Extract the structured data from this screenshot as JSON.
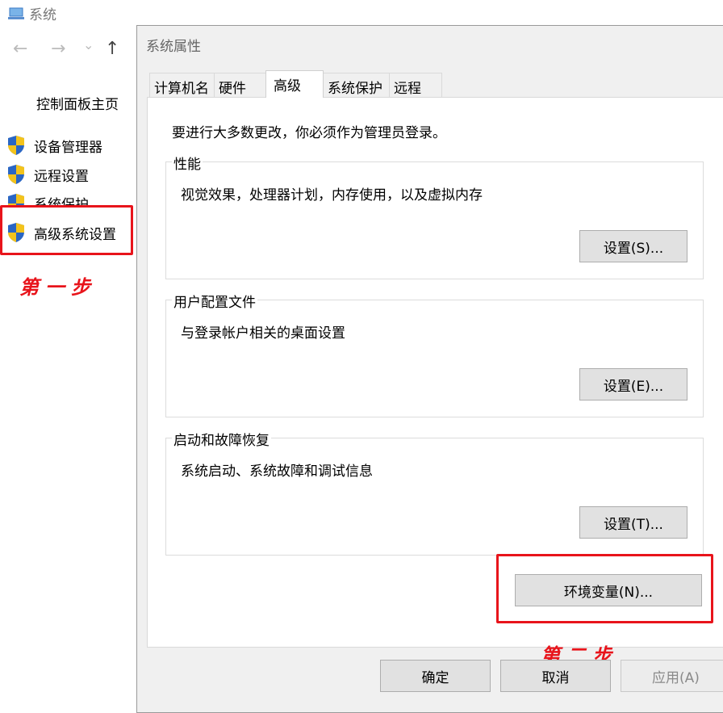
{
  "window": {
    "title": "系统"
  },
  "nav": {
    "back": "←",
    "forward": "→",
    "dropdown": "⌄",
    "up": "↑"
  },
  "sidebar": {
    "home": "控制面板主页",
    "items": [
      {
        "label": "设备管理器"
      },
      {
        "label": "远程设置"
      },
      {
        "label": "系统保护"
      },
      {
        "label": "高级系统设置"
      }
    ]
  },
  "annotations": {
    "step1": "第一步",
    "step2": "第二步",
    "highlight_color": "#e8141b"
  },
  "dialog": {
    "title": "系统属性",
    "tabs": [
      {
        "label": "计算机名"
      },
      {
        "label": "硬件"
      },
      {
        "label": "高级",
        "active": true
      },
      {
        "label": "系统保护"
      },
      {
        "label": "远程"
      }
    ],
    "admin_notice": "要进行大多数更改，你必须作为管理员登录。",
    "groups": [
      {
        "title": "性能",
        "description": "视觉效果，处理器计划，内存使用，以及虚拟内存",
        "button": "设置(S)..."
      },
      {
        "title": "用户配置文件",
        "description": "与登录帐户相关的桌面设置",
        "button": "设置(E)..."
      },
      {
        "title": "启动和故障恢复",
        "description": "系统启动、系统故障和调试信息",
        "button": "设置(T)..."
      }
    ],
    "env_button": "环境变量(N)...",
    "ok": "确定",
    "cancel": "取消",
    "apply": "应用(A)"
  }
}
